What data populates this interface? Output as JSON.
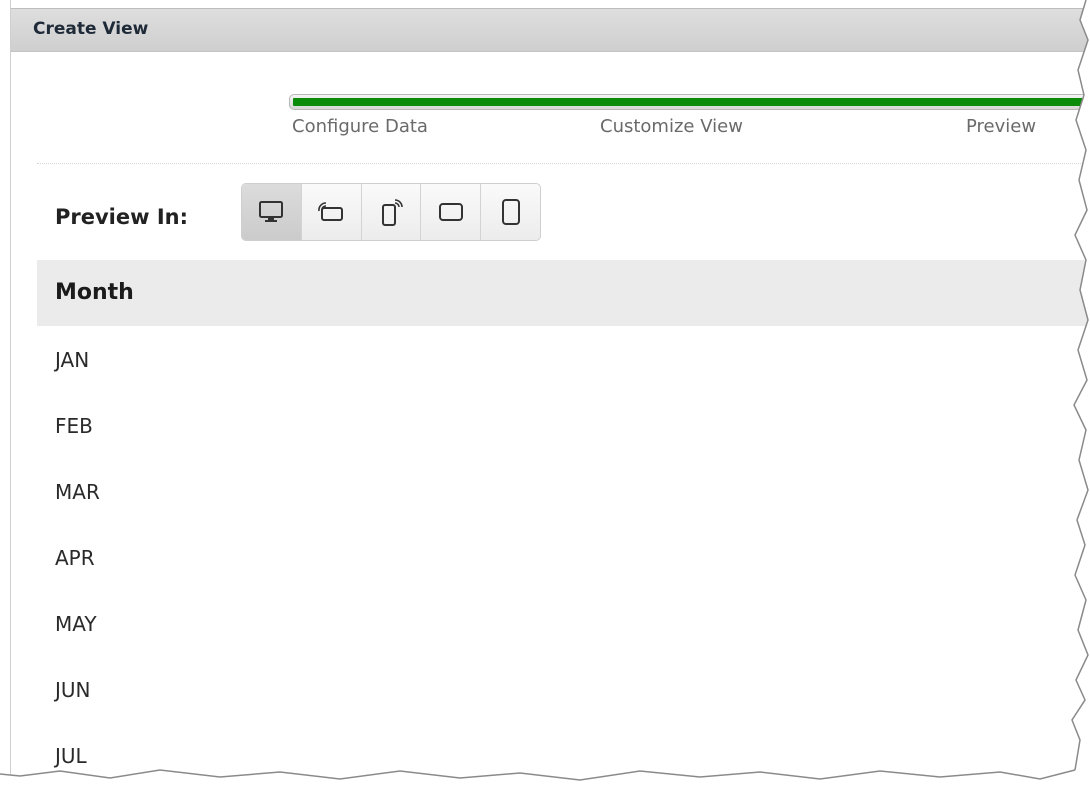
{
  "window": {
    "title": "Create View"
  },
  "wizard": {
    "progress_percent": 100,
    "steps": [
      "Configure Data",
      "Customize View",
      "Preview"
    ]
  },
  "preview": {
    "label": "Preview In:",
    "devices": [
      "desktop-icon",
      "phone-landscape-icon",
      "phone-portrait-icon",
      "tablet-landscape-icon",
      "tablet-portrait-icon"
    ],
    "selected_device": "desktop-icon"
  },
  "table": {
    "columns": [
      "Month"
    ],
    "rows": [
      "JAN",
      "FEB",
      "MAR",
      "APR",
      "MAY",
      "JUN",
      "JUL"
    ]
  },
  "colors": {
    "progress": "#0a8c0a",
    "titlebar": "#d4d4d4",
    "header_bg": "#ebebeb"
  }
}
